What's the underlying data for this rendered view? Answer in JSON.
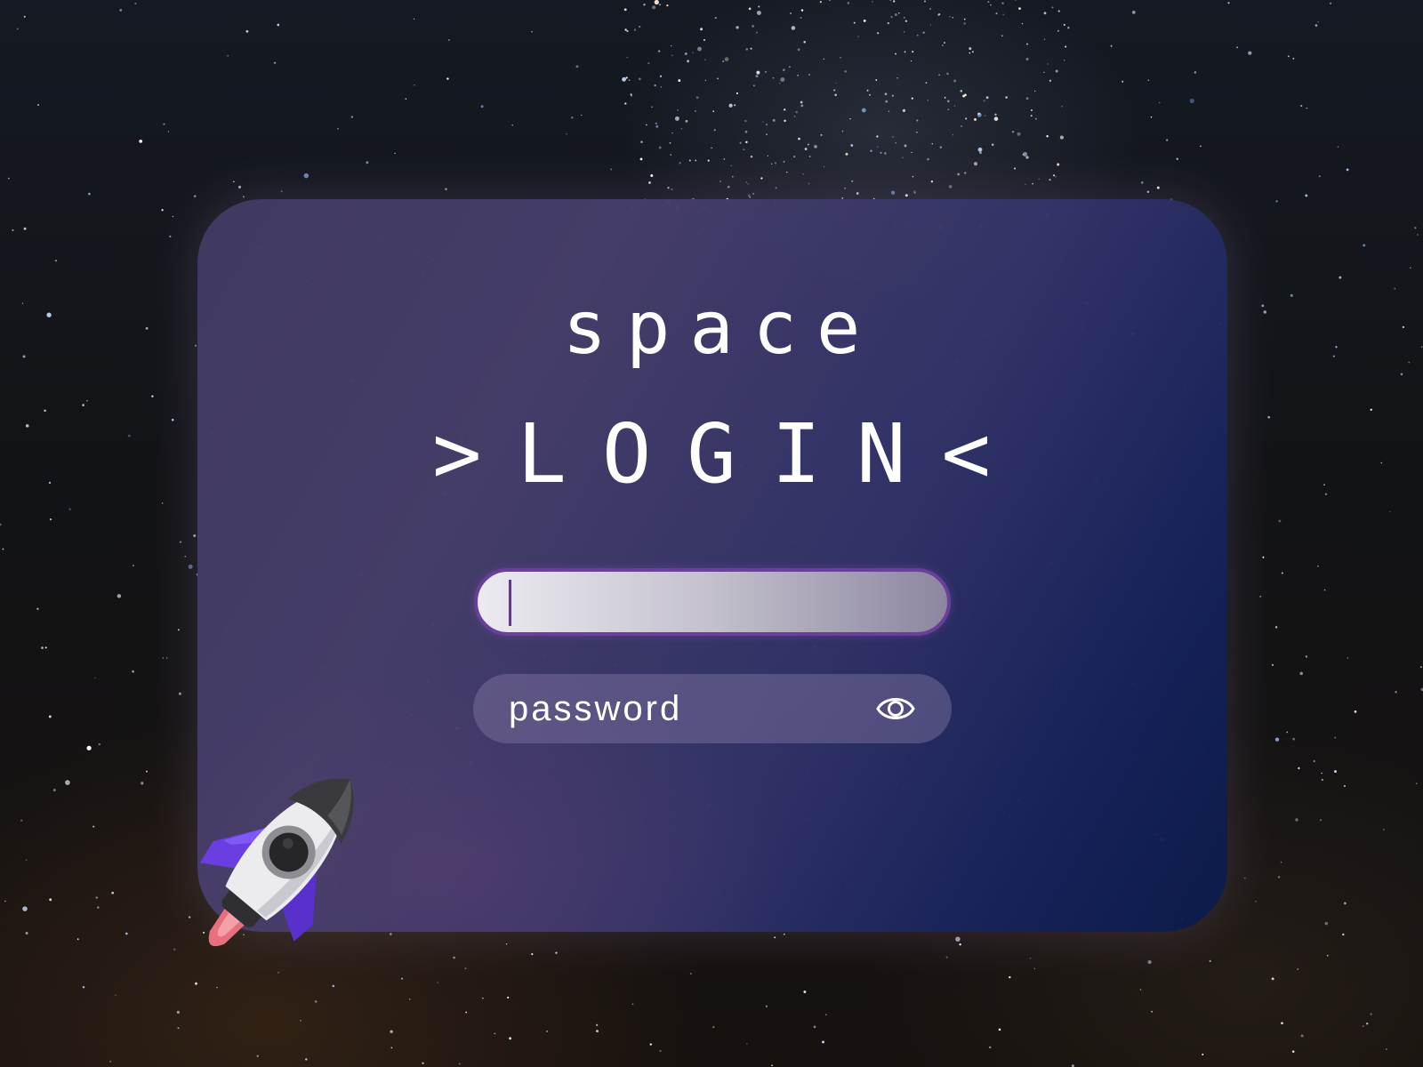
{
  "header": {
    "app_word": "space",
    "title": ">LOGIN<"
  },
  "form": {
    "username": {
      "value": "",
      "placeholder": "",
      "focused": true
    },
    "password": {
      "placeholder": "password",
      "visibility_icon": "eye-icon"
    }
  },
  "decor": {
    "illustration": "rocket-illustration",
    "background": "starry-night-sky"
  },
  "colors": {
    "card_gradient_start": "#433c65",
    "card_gradient_end": "#0c1c4a",
    "input_border": "#6a3f9a",
    "rocket_fins": "#6a3ee0",
    "rocket_flame": "#e86a7a",
    "text": "#ffffff"
  }
}
